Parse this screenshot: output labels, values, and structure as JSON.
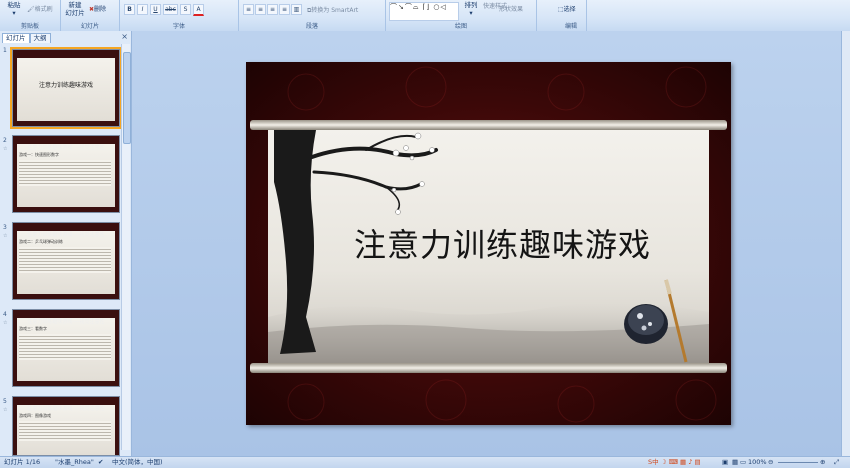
{
  "ribbon": {
    "clipboard": {
      "paste": "粘贴",
      "format_painter": "格式刷",
      "label": "剪贴板"
    },
    "slides": {
      "new_slide": "新建\n幻灯片",
      "delete": "删除",
      "label": "幻灯片"
    },
    "font": {
      "label": "字体",
      "buttons": [
        "B",
        "I",
        "U",
        "abc",
        "S",
        "A"
      ]
    },
    "paragraph": {
      "label": "段落",
      "smartart": "转换为 SmartArt"
    },
    "drawing": {
      "label": "绘图",
      "arrange": "排列",
      "quick_styles": "快速样式",
      "shape_effects": "形状效果"
    },
    "editing": {
      "label": "编辑",
      "select": "选择"
    }
  },
  "left_panel": {
    "tabs": [
      "幻灯片",
      "大纲"
    ],
    "close": "×",
    "thumbnails": [
      {
        "num": "1",
        "star": "",
        "title": "注意力训练趣味游戏",
        "selected": true
      },
      {
        "num": "2",
        "star": "☆",
        "title": "注意力训练趣味游戏----视觉注意性",
        "sub": "游戏一：快速图形数字",
        "selected": false
      },
      {
        "num": "3",
        "star": "☆",
        "title": "注意力训练趣味游戏----视觉注意性",
        "sub": "游戏二：乒乓球弹动训练",
        "selected": false
      },
      {
        "num": "4",
        "star": "☆",
        "title": "注意力训练趣味游戏----视觉注意性",
        "sub": "游戏三：看数字",
        "selected": false
      },
      {
        "num": "5",
        "star": "☆",
        "title": "注意力训练趣味游戏----视觉注意性",
        "sub": "游戏四：图像游戏",
        "selected": false
      }
    ]
  },
  "slide": {
    "title": "注意力训练趣味游戏"
  },
  "status_bar": {
    "slide_count": "幻灯片 1/16",
    "theme": "\"水墨_Rhea\"",
    "language": "中文(简体，中国)",
    "zoom": "100%"
  },
  "colors": {
    "ribbon_bg": "#d6e5f7",
    "selected_outline": "#f5a623",
    "slide_border": "#3b0808"
  }
}
